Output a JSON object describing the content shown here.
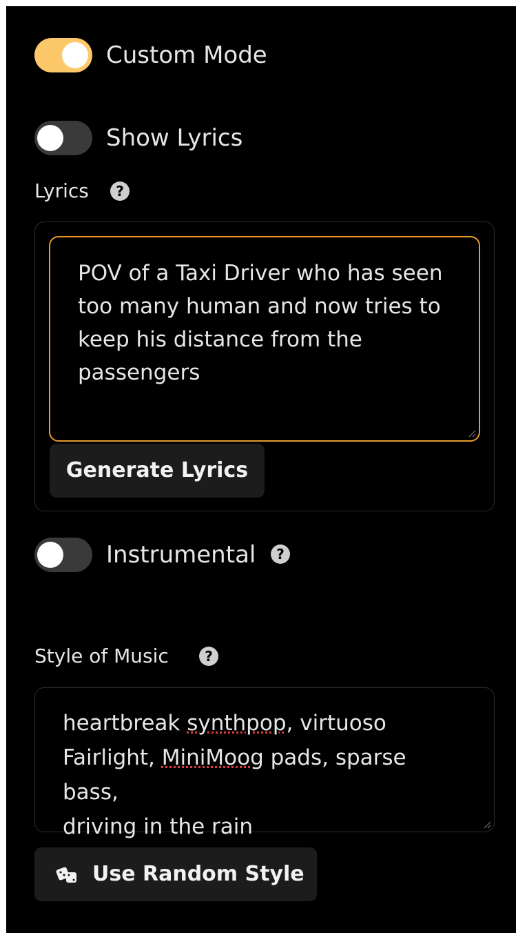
{
  "custom_mode": {
    "label": "Custom Mode",
    "enabled": true
  },
  "show_lyrics": {
    "label": "Show Lyrics",
    "enabled": false
  },
  "lyrics": {
    "label": "Lyrics",
    "value": "POV of a Taxi Driver who has seen too many human and now tries to keep his distance from the passengers",
    "line1": "POV of a Taxi Driver who has seen",
    "line2": "too many human and now tries to",
    "line3": "keep his distance from the",
    "line4": "passengers",
    "generate_button": "Generate Lyrics"
  },
  "instrumental": {
    "label": "Instrumental",
    "enabled": false
  },
  "style": {
    "label": "Style of Music",
    "value": "heartbreak synthpop, virtuoso Fairlight, MiniMoog pads, sparse bass, driving in the rain",
    "line1_a": "heartbreak ",
    "line1_b": "synthpop",
    "line1_c": ", virtuoso",
    "line2_a": "Fairlight, ",
    "line2_b": "MiniMoog",
    "line2_c": " pads, sparse bass,",
    "line3": "driving in the rain",
    "random_button": "Use Random Style",
    "random_icon": "dice-icon"
  },
  "colors": {
    "accent": "#fcc86a",
    "focus_border": "#e89a2a",
    "background": "#000000"
  }
}
